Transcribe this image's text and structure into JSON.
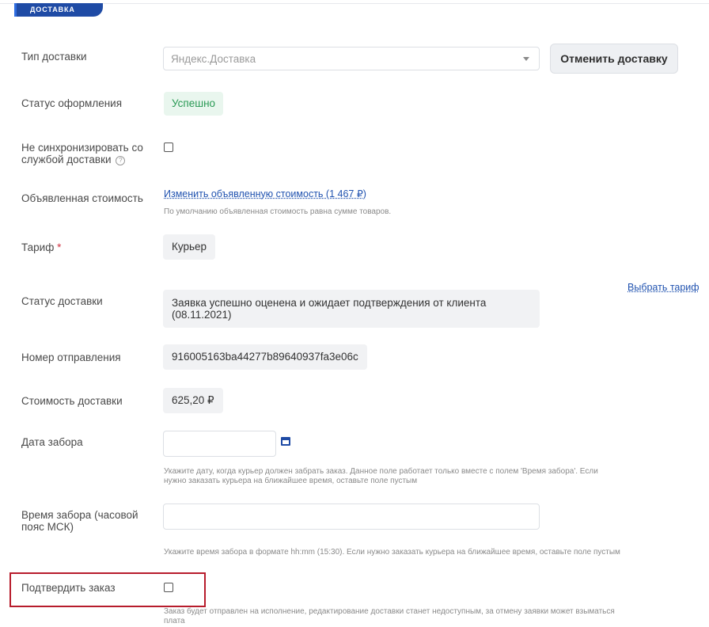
{
  "section": {
    "title": "ДОСТАВКА"
  },
  "delivery_type": {
    "label": "Тип доставки",
    "value": "Яндекс.Доставка",
    "cancel_button": "Отменить доставку"
  },
  "registration_status": {
    "label": "Статус оформления",
    "value": "Успешно"
  },
  "no_sync": {
    "label_line1": "Не синхронизировать со",
    "label_line2": "службой доставки",
    "help": "?",
    "checked": false
  },
  "declared_value": {
    "label": "Объявленная стоимость",
    "link": "Изменить объявленную стоимость (1 467 ₽)",
    "hint": "По умолчанию объявленная стоимость равна сумме товаров."
  },
  "tariff": {
    "label": "Тариф",
    "required_mark": "*",
    "value": "Курьер",
    "choose_link": "Выбрать тариф"
  },
  "delivery_status": {
    "label": "Статус доставки",
    "value_line1": "Заявка успешно оценена и ожидает подтверждения от клиента",
    "value_line2": "(08.11.2021)"
  },
  "tracking": {
    "label": "Номер отправления",
    "value": "916005163ba44277b89640937fa3e06c"
  },
  "delivery_cost": {
    "label": "Стоимость доставки",
    "value": "625,20 ₽"
  },
  "pickup_date": {
    "label": "Дата забора",
    "value": "",
    "hint_line1": "Укажите дату, когда курьер должен забрать заказ. Данное поле работает только вместе с полем 'Время забора'. Если",
    "hint_line2": "нужно заказать курьера на ближайшее время, оставьте поле пустым"
  },
  "pickup_time": {
    "label_line1": "Время забора (часовой",
    "label_line2": "пояс МСК)",
    "value": "",
    "hint": "Укажите время забора в формате hh:mm (15:30). Если нужно заказать курьера на ближайшее время, оставьте поле пустым"
  },
  "confirm_order": {
    "label": "Подтвердить заказ",
    "checked": false,
    "hint_line1": "Заказ будет отправлен на исполнение, редактирование доставки станет недоступным, за отмену заявки может взыматься",
    "hint_line2": "плата"
  },
  "colors": {
    "accent": "#1f4ba5",
    "success_text": "#2a9a55",
    "success_bg": "#e9f6ee",
    "highlight": "#b71c2c",
    "link": "#2153b0"
  }
}
